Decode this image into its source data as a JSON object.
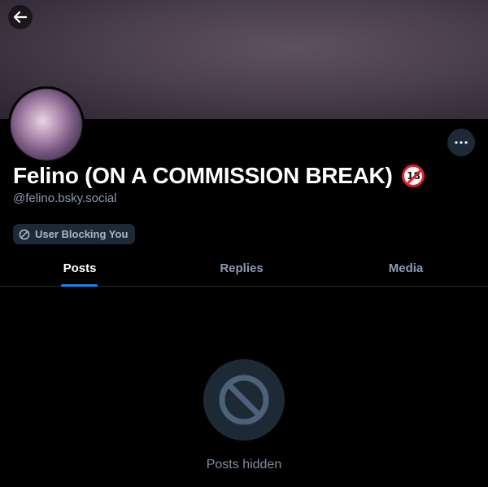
{
  "profile": {
    "display_name": "Felino (ON A COMMISSION BREAK)",
    "handle": "@felino.bsky.social",
    "age_badge_text": "18",
    "blocking_label": "User Blocking You"
  },
  "tabs": [
    {
      "label": "Posts",
      "active": true
    },
    {
      "label": "Replies",
      "active": false
    },
    {
      "label": "Media",
      "active": false
    }
  ],
  "empty_state": {
    "text": "Posts hidden"
  },
  "icons": {
    "back": "arrow-left-icon",
    "more": "ellipsis-icon",
    "blocked": "block-icon",
    "empty": "block-icon"
  },
  "colors": {
    "background": "#000000",
    "accent": "#1083fe",
    "muted_text": "#8a9bb0",
    "pill_bg": "#1e2936"
  }
}
